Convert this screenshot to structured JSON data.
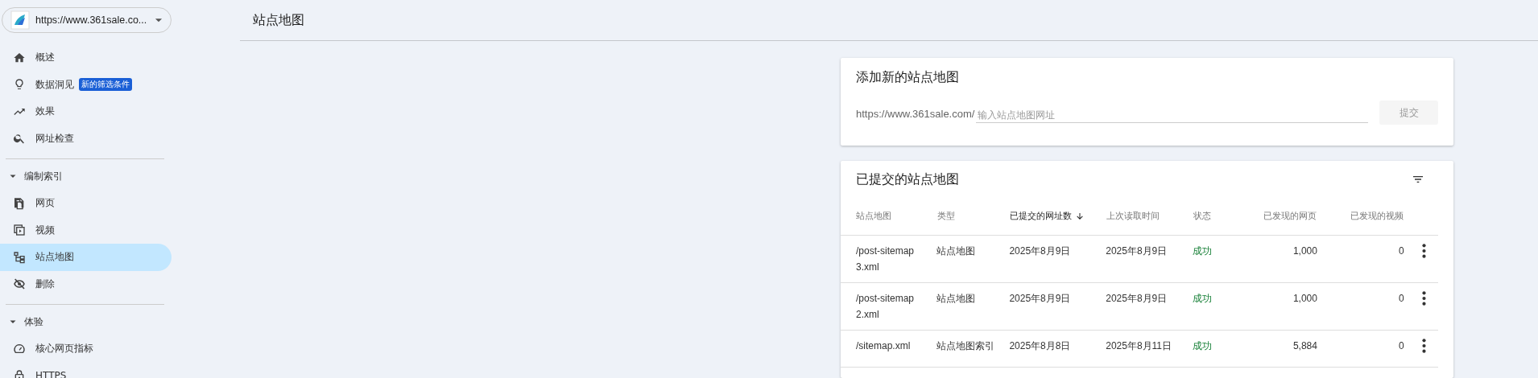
{
  "property_selector": {
    "label": "https://www.361sale.co..."
  },
  "nav": [
    {
      "label": "概述",
      "selected": false
    },
    {
      "label": "数据洞见",
      "selected": false,
      "badge": "新的筛选条件"
    },
    {
      "label": "效果",
      "selected": false
    },
    {
      "label": "网址检查",
      "selected": false
    },
    {
      "label": "编制索引",
      "expanded": true,
      "children": [
        {
          "label": "网页",
          "selected": false
        },
        {
          "label": "视频",
          "selected": false
        },
        {
          "label": "站点地图",
          "selected": true
        },
        {
          "label": "删除",
          "selected": false
        }
      ]
    },
    {
      "label": "体验",
      "expanded": true,
      "children": [
        {
          "label": "核心网页指标",
          "selected": false
        },
        {
          "label": "HTTPS",
          "selected": false
        }
      ]
    }
  ],
  "page_title": "站点地图",
  "add_card": {
    "title": "添加新的站点地图",
    "prefix": "https://www.361sale.com/",
    "placeholder": "输入站点地图网址",
    "button": {
      "label": "提交",
      "disabled": true
    }
  },
  "table_card": {
    "title": "已提交的站点地图",
    "columns": [
      {
        "label": "站点地图",
        "sorted": false
      },
      {
        "label": "类型",
        "sorted": false
      },
      {
        "label": "已提交的网址数",
        "sorted": true
      },
      {
        "label": "上次读取时间",
        "sorted": false
      },
      {
        "label": "状态",
        "sorted": false
      },
      {
        "label": "已发现的网页",
        "sorted": false
      },
      {
        "label": "已发现的视频",
        "sorted": false
      }
    ],
    "rows": [
      {
        "cells": [
          "/post-sitemap3.xml",
          "站点地图",
          "2025年8月9日",
          "2025年8月9日",
          "成功",
          "1,000",
          "0"
        ]
      },
      {
        "cells": [
          "/post-sitemap2.xml",
          "站点地图",
          "2025年8月9日",
          "2025年8月9日",
          "成功",
          "1,000",
          "0"
        ]
      },
      {
        "cells": [
          "/sitemap.xml",
          "站点地图索引",
          "2025年8月8日",
          "2025年8月11日",
          "成功",
          "5,884",
          "0"
        ]
      }
    ]
  }
}
